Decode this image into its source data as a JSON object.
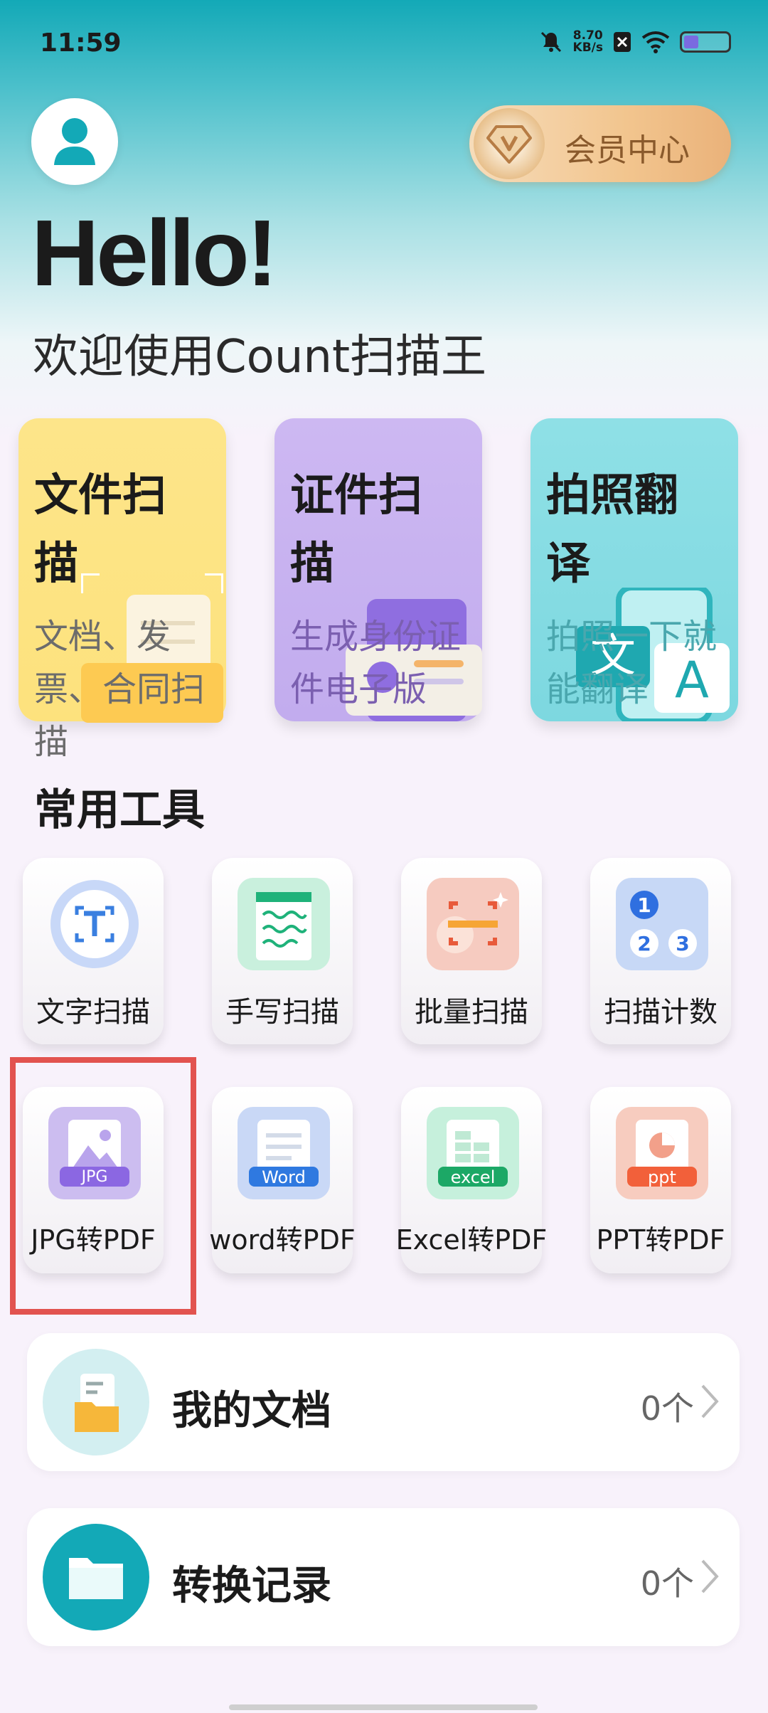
{
  "status_bar": {
    "time": "11:59",
    "speed_value": "8.70",
    "speed_unit": "KB/s"
  },
  "header": {
    "vip_label": "会员中心",
    "greeting": "Hello!",
    "welcome": "欢迎使用Count扫描王"
  },
  "features": [
    {
      "title": "文件扫描",
      "subtitle": "文档、发票、合同扫描"
    },
    {
      "title": "证件扫描",
      "subtitle": "生成身份证件电子版"
    },
    {
      "title": "拍照翻译",
      "subtitle": "拍照一下就能翻译"
    }
  ],
  "tools_section": {
    "title": "常用工具",
    "items": [
      {
        "label": "文字扫描"
      },
      {
        "label": "手写扫描"
      },
      {
        "label": "批量扫描"
      },
      {
        "label": "扫描计数"
      },
      {
        "label": "JPG转PDF",
        "badge": "JPG"
      },
      {
        "label": "word转PDF",
        "badge": "Word"
      },
      {
        "label": "Excel转PDF",
        "badge": "excel"
      },
      {
        "label": "PPT转PDF",
        "badge": "ppt"
      }
    ]
  },
  "list": [
    {
      "title": "我的文档",
      "count": "0个"
    },
    {
      "title": "转换记录",
      "count": "0个"
    }
  ],
  "icons": {
    "avatar": "user-icon",
    "vip": "diamond-icon",
    "chevron": "chevron-right-icon"
  },
  "colors": {
    "accent_teal": "#13a9b7",
    "highlight": "#e2534f",
    "vip_gold": "#eab27a"
  }
}
